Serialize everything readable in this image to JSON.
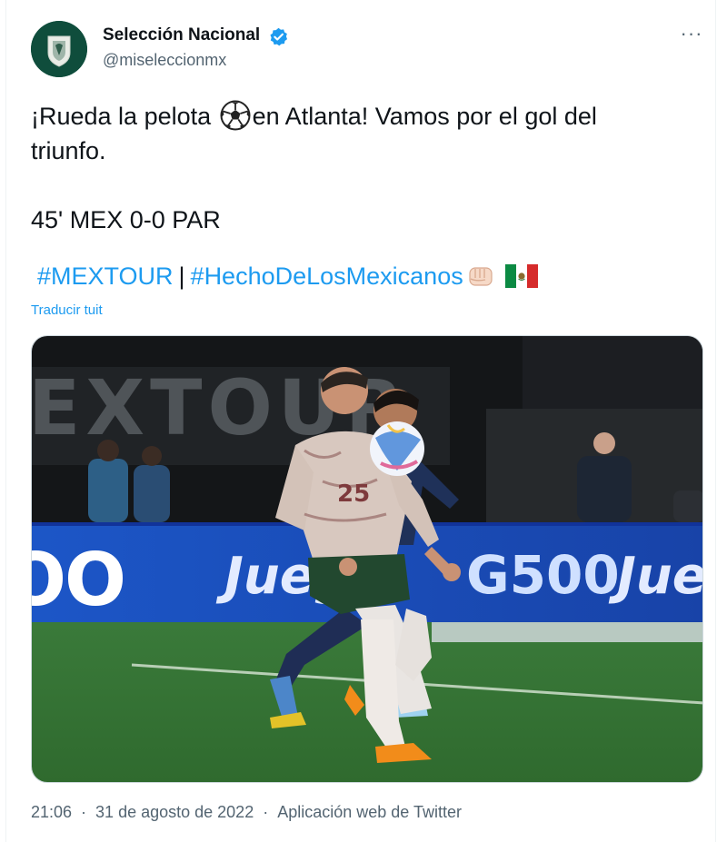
{
  "account": {
    "display_name": "Selección Nacional",
    "handle": "@miseleccionmx",
    "verified": true,
    "avatar_icon": "mexico-federation-crest-icon"
  },
  "menu": {
    "more_label": "···"
  },
  "tweet": {
    "line1_before": "¡Rueda la pelota ",
    "line1_emoji": "soccer-ball-icon",
    "line1_after": "en Atlanta! Vamos por el gol del",
    "line2": "triunfo.",
    "score": "45' MEX 0-0 PAR",
    "hashtags": [
      "#MEXTOUR",
      "#HechoDeLosMexicanos"
    ],
    "separator": "|",
    "trailing_emojis": [
      "fist-icon",
      "mexico-flag-icon"
    ]
  },
  "translate_label": "Traducir tuit",
  "media": {
    "board_text": "EXTOUR",
    "ad_text_left": "OO",
    "ad_text_juega": "Juega",
    "ad_text_g500": "G500",
    "ad_text_right": "Juega",
    "player_number": "25"
  },
  "footer": {
    "time": "21:06",
    "date": "31 de agosto de 2022",
    "source": "Aplicación web de Twitter",
    "dot": "·"
  },
  "colors": {
    "link": "#1d9bf0",
    "secondary_text": "#536471",
    "primary_text": "#0f1419",
    "verified": "#1d9bf0"
  }
}
